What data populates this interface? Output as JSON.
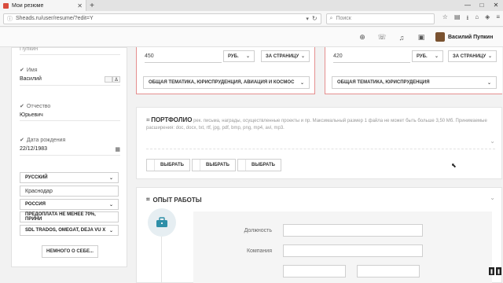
{
  "browser": {
    "tab_title": "Мои резюме",
    "url": "Sheads.ru/user/resume/?edit=Y",
    "search_placeholder": "Поиск"
  },
  "header": {
    "user_name": "Василий Пупкин"
  },
  "profile": {
    "last_name_value": "Пупкин",
    "first_name_label": "Имя",
    "first_name_value": "Василий",
    "patronymic_label": "Отчество",
    "patronymic_value": "Юрьевич",
    "birth_date_label": "Дата рождения",
    "birth_date_value": "22/12/1983",
    "language_select": "РУССКИЙ",
    "city_input": "Краснодар",
    "country_select": "РОССИЯ",
    "payment_select": "ПРЕДОПЛАТА НЕ МЕНЕЕ 70%, ПРИНИ",
    "tools_select": "SDL TRADOS, OMEGAT, DEJA VU X",
    "about_button": "НЕМНОГО О СЕБЕ..."
  },
  "rate_left": {
    "price": "450",
    "currency": "РУБ.",
    "unit": "ЗА СТРАНИЦУ",
    "topics": "ОБЩАЯ ТЕМАТИКА, ЮРИСПРУДЕНЦИЯ, АВИАЦИЯ И КОСМОС"
  },
  "rate_right": {
    "price": "420",
    "currency": "РУБ.",
    "unit": "ЗА СТРАНИЦУ",
    "topics": "ОБЩАЯ ТЕМАТИКА, ЮРИСПРУДЕНЦИЯ"
  },
  "portfolio": {
    "title": "ПОРТФОЛИО",
    "description": "рек. письма, награды, осуществленные проекты и пр. Максимальный размер 1 файла не может быть больше 3,50 Мб. Принимаемые расширения: doc, docx, txt, rtf, jpg, pdf, bmp, png, mp4, avi, mp3.",
    "choose_labels": [
      "ВЫБРАТЬ",
      "ВЫБРАТЬ",
      "ВЫБРАТЬ"
    ]
  },
  "experience": {
    "title": "ОПЫТ РАБОТЫ",
    "position_label": "Должность",
    "company_label": "Компания"
  },
  "icons": [
    "plus-circle-icon",
    "chat-icon",
    "bell-icon",
    "id-card-icon",
    "tag-icon",
    "briefcase-icon",
    "calendar-icon",
    "chevron-down-icon"
  ],
  "colors": {
    "accent_border": "#e58f8f",
    "briefcase": "#2f8fa8"
  }
}
